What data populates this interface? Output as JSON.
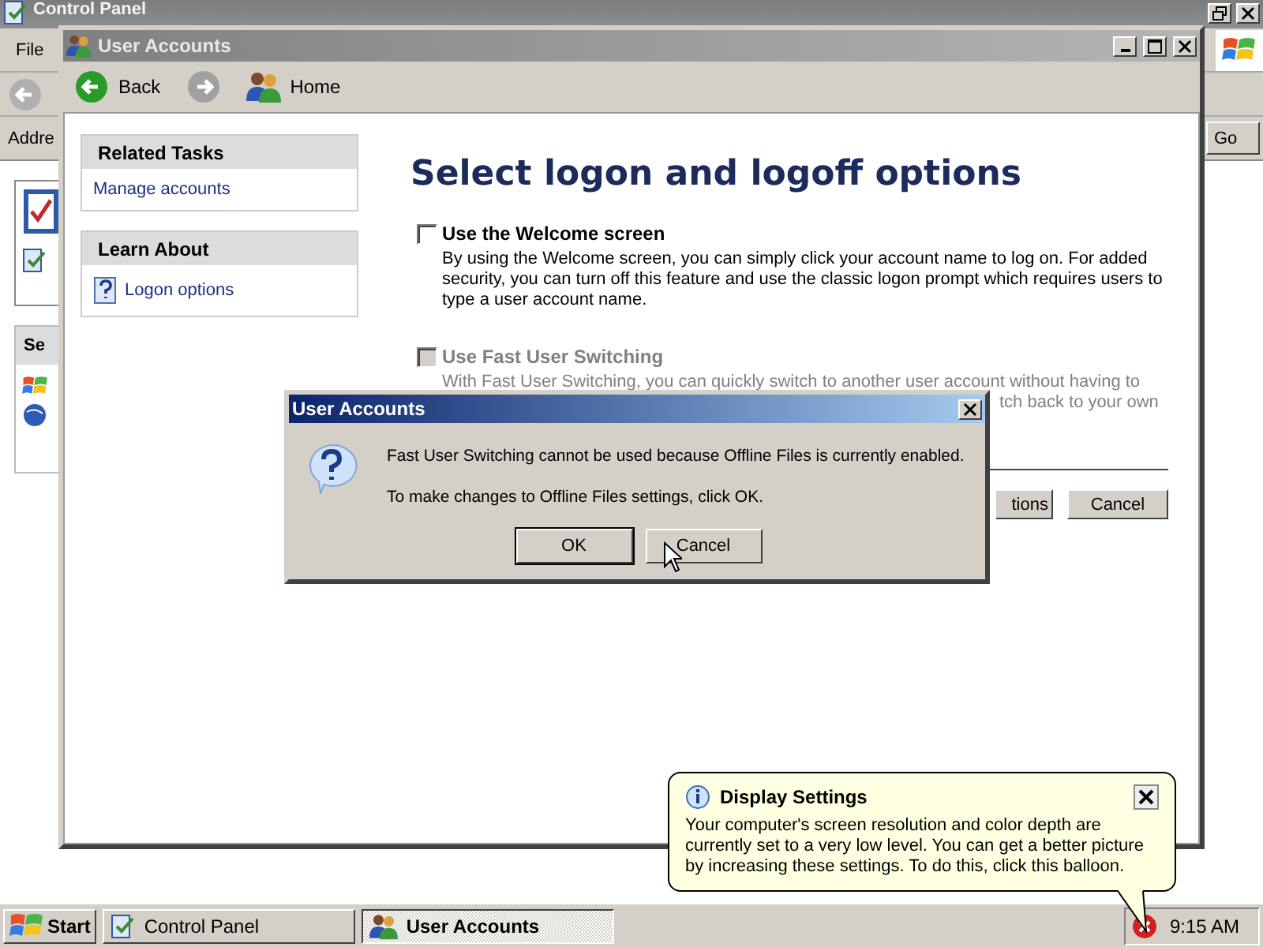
{
  "control_panel": {
    "title": "Control Panel",
    "menu": [
      "File"
    ],
    "address_label": "Addre",
    "go_button": "Go",
    "task_section": "Se"
  },
  "user_accounts": {
    "title": "User Accounts",
    "toolbar": [
      {
        "kind": "back",
        "label": "Back",
        "disabled": false
      },
      {
        "kind": "forward",
        "disabled": true
      },
      {
        "kind": "home",
        "label": "Home",
        "disabled": false
      }
    ],
    "sidebar": [
      {
        "title": "Related Tasks",
        "items": [
          {
            "label": "Manage accounts",
            "kind": "link"
          }
        ]
      },
      {
        "title": "Learn About",
        "items": [
          {
            "label": "Logon options",
            "kind": "help"
          }
        ]
      }
    ],
    "heading": "Select logon and logoff options",
    "options": [
      {
        "label": "Use the Welcome screen",
        "checked": false,
        "disabled": false,
        "description": "By using the Welcome screen, you can simply click your account name to log on. For added security, you can turn off this feature and use the classic logon prompt which requires users to type a user account name."
      },
      {
        "label": "Use Fast User Switching",
        "checked": false,
        "disabled": true,
        "description": "With Fast User Switching, you can quickly switch to another user account without having to",
        "description_fragment": "tch back to your own"
      }
    ],
    "buttons": [
      "tions",
      "Cancel"
    ]
  },
  "dialog": {
    "title": "User Accounts",
    "messages": [
      "Fast User Switching cannot be used because Offline Files is currently enabled.",
      "To make changes to Offline Files settings, click OK."
    ],
    "buttons": [
      {
        "label": "OK",
        "default": true
      },
      {
        "label": "Cancel",
        "default": false
      }
    ]
  },
  "balloon": {
    "title": "Display Settings",
    "text": "Your computer's screen resolution and color depth are currently set to a very low level. You can get a better picture by increasing these settings. To do this, click this balloon."
  },
  "taskbar": {
    "start": "Start",
    "tasks": [
      {
        "label": "Control Panel",
        "kind": "control-panel",
        "selected": false
      },
      {
        "label": "User Accounts",
        "kind": "users",
        "selected": true
      }
    ],
    "clock": "9:15 AM"
  }
}
